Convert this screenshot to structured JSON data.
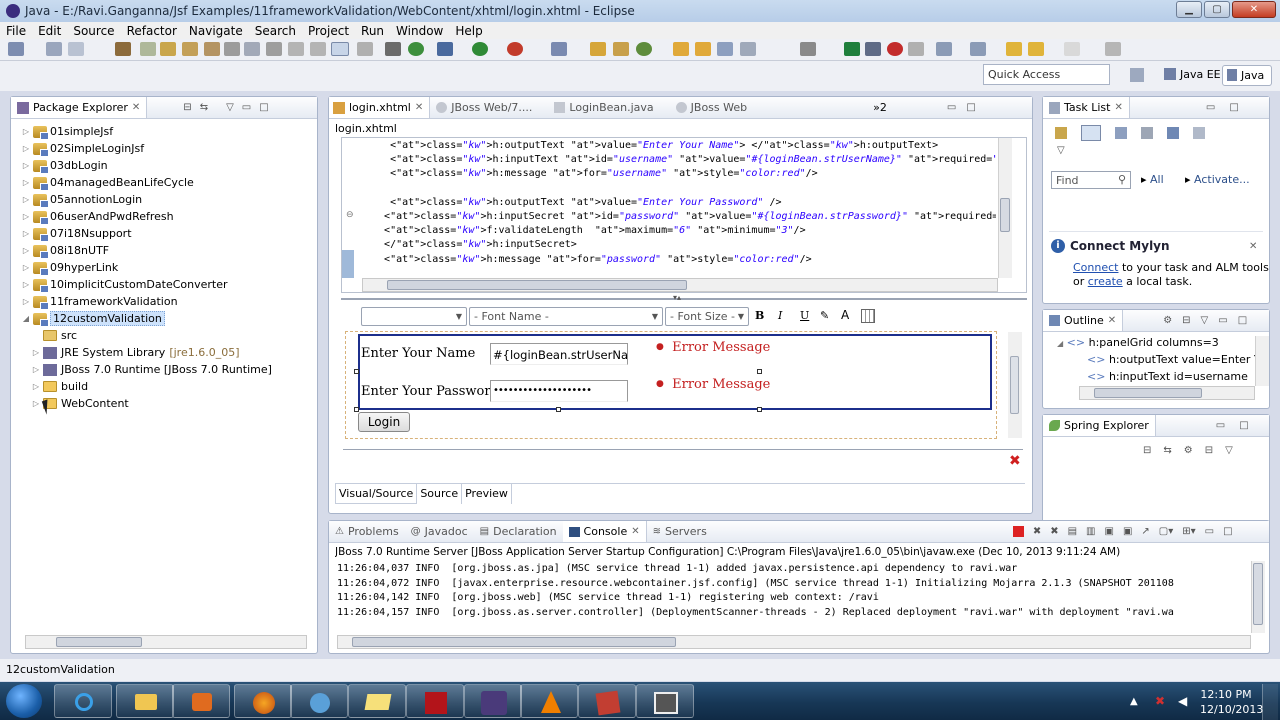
{
  "window": {
    "title": "Java - E:/Ravi.Ganganna/Jsf Examples/11frameworkValidation/WebContent/xhtml/login.xhtml - Eclipse"
  },
  "menu": [
    "File",
    "Edit",
    "Source",
    "Refactor",
    "Navigate",
    "Search",
    "Project",
    "Run",
    "Window",
    "Help"
  ],
  "quick_access": {
    "placeholder": "Quick Access"
  },
  "perspectives": {
    "javaee": "Java EE",
    "java": "Java"
  },
  "package_explorer": {
    "title": "Package Explorer",
    "projects": [
      "01simpleJsf",
      "02SimpleLoginJsf",
      "03dbLogin",
      "04managedBeanLifeCycle",
      "05annotionLogin",
      "06userAndPwdRefresh",
      "07i18Nsupport",
      "08i18nUTF",
      "09hyperLink",
      "10implicitCustomDateConverter",
      "11frameworkValidation",
      "12customValidation"
    ],
    "children": [
      {
        "label": "src",
        "icon": "package-folder-icon"
      },
      {
        "label": "JRE System Library",
        "suffix": "[jre1.6.0_05]",
        "icon": "library-icon"
      },
      {
        "label": "JBoss 7.0 Runtime [JBoss 7.0 Runtime]",
        "suffix": "",
        "icon": "library-icon"
      },
      {
        "label": "build",
        "icon": "folder-icon"
      },
      {
        "label": "WebContent",
        "icon": "folder-icon"
      }
    ]
  },
  "editor": {
    "tabs": [
      "login.xhtml",
      "JBoss Web/7....",
      "LoginBean.java",
      "JBoss Web"
    ],
    "overflow": "»2",
    "breadcrumb": "login.xhtml",
    "source_lines": [
      "    <h:outputText value=\"Enter Your Name\"> </h:outputText>",
      "    <h:inputText id=\"username\" value=\"#{loginBean.strUserName}\" required=\"true\"  immediate=\"true\"",
      "    <h:message for=\"username\" style=\"color:red\"/>",
      "",
      "    <h:outputText value=\"Enter Your Password\" />",
      "   <h:inputSecret id=\"password\" value=\"#{loginBean.strPassword}\" required=\"true\" requiredMessage=",
      "   <f:validateLength  maximum=\"6\" minimum=\"3\"/>",
      "   </h:inputSecret>",
      "   <h:message for=\"password\" style=\"color:red\"/>"
    ],
    "format": {
      "font_name": "- Font Name -",
      "font_size": "- Font Size -"
    },
    "preview": {
      "name_label": "Enter Your Name",
      "name_value": "#{loginBean.strUserNar",
      "name_error": "Error Message",
      "pwd_label": "Enter Your Password",
      "pwd_value": "••••••••••••••••••••",
      "pwd_error": "Error Message",
      "login_button": "Login"
    },
    "bottom_tabs": [
      "Visual/Source",
      "Source",
      "Preview"
    ]
  },
  "task_list": {
    "title": "Task List",
    "find_placeholder": "Find",
    "all": "All",
    "activate": "Activate...",
    "mylyn_title": "Connect Mylyn",
    "mylyn_connect": "Connect",
    "mylyn_text1": " to your task and ALM tools",
    "mylyn_or": "or ",
    "mylyn_create": "create",
    "mylyn_text2": " a local task."
  },
  "outline": {
    "title": "Outline",
    "items": [
      "h:panelGrid columns=3",
      "h:outputText value=Enter Yo",
      "h:inputText id=username"
    ]
  },
  "spring": {
    "title": "Spring Explorer"
  },
  "bottom_panel": {
    "tabs": [
      "Problems",
      "Javadoc",
      "Declaration",
      "Console",
      "Servers"
    ],
    "server_line": "JBoss 7.0 Runtime Server [JBoss Application Server Startup Configuration] C:\\Program Files\\Java\\jre1.6.0_05\\bin\\javaw.exe (Dec 10, 2013 9:11:24 AM)",
    "lines": [
      "11:26:04,037 INFO  [org.jboss.as.jpa] (MSC service thread 1-1) added javax.persistence.api dependency to ravi.war",
      "11:26:04,072 INFO  [javax.enterprise.resource.webcontainer.jsf.config] (MSC service thread 1-1) Initializing Mojarra 2.1.3 (SNAPSHOT 201108",
      "11:26:04,142 INFO  [org.jboss.web] (MSC service thread 1-1) registering web context: /ravi",
      "11:26:04,157 INFO  [org.jboss.as.server.controller] (DeploymentScanner-threads - 2) Replaced deployment \"ravi.war\" with deployment \"ravi.wa"
    ]
  },
  "status_bar": {
    "text": "12customValidation"
  },
  "taskbar": {
    "time": "12:10 PM",
    "date": "12/10/2013"
  },
  "colors": {
    "accent": "#3b6ea5",
    "error": "#c42020",
    "selection": "#cde2fb"
  }
}
